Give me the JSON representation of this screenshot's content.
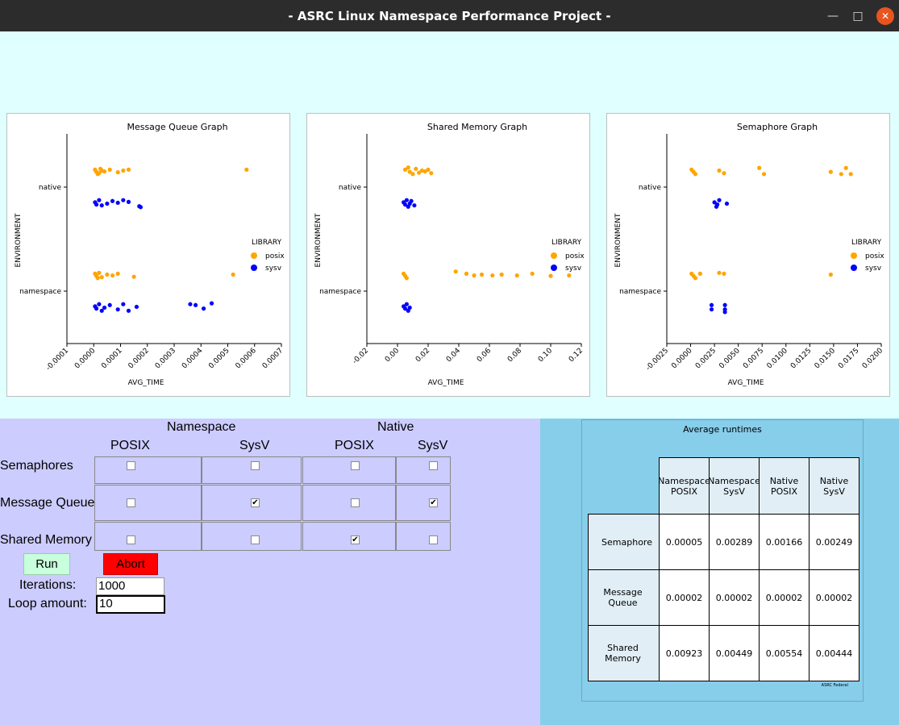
{
  "window": {
    "title": "- ASRC Linux Namespace Performance Project -"
  },
  "charts": [
    {
      "title": "Message Queue Graph",
      "xlabel": "AVG_TIME",
      "ylabel": "ENVIRONMENT",
      "yticks": [
        "native",
        "namespace"
      ],
      "xticks": [
        "-0.0001",
        "0.0000",
        "0.0001",
        "0.0002",
        "0.0003",
        "0.0004",
        "0.0005",
        "0.0006",
        "0.0007"
      ],
      "legend_title": "LIBRARY",
      "legend": [
        "posix",
        "sysv"
      ]
    },
    {
      "title": "Shared Memory Graph",
      "xlabel": "AVG_TIME",
      "ylabel": "ENVIRONMENT",
      "yticks": [
        "native",
        "namespace"
      ],
      "xticks": [
        "-0.02",
        "0.00",
        "0.02",
        "0.04",
        "0.06",
        "0.08",
        "0.10",
        "0.12"
      ],
      "legend_title": "LIBRARY",
      "legend": [
        "posix",
        "sysv"
      ]
    },
    {
      "title": "Semaphore Graph",
      "xlabel": "AVG_TIME",
      "ylabel": "ENVIRONMENT",
      "yticks": [
        "native",
        "namespace"
      ],
      "xticks": [
        "-0.0025",
        "0.0000",
        "0.0025",
        "0.0050",
        "0.0075",
        "0.0100",
        "0.0125",
        "0.0150",
        "0.0175",
        "0.0200"
      ],
      "legend_title": "LIBRARY",
      "legend": [
        "posix",
        "sysv"
      ]
    }
  ],
  "chart_data": [
    {
      "type": "scatter",
      "title": "Message Queue Graph",
      "xlabel": "AVG_TIME",
      "ylabel": "ENVIRONMENT",
      "xlim": [
        -0.0001,
        0.0007
      ],
      "categories": [
        "native",
        "namespace"
      ],
      "legend_position": "right",
      "series": [
        {
          "name": "posix",
          "color": "#ffa500",
          "points": [
            {
              "env": "native",
              "offset": -0.4,
              "x": 5e-06
            },
            {
              "env": "native",
              "offset": -0.35,
              "x": 1e-05
            },
            {
              "env": "native",
              "offset": -0.3,
              "x": 1.5e-05
            },
            {
              "env": "native",
              "offset": -0.32,
              "x": 2e-05
            },
            {
              "env": "native",
              "offset": -0.42,
              "x": 2.5e-05
            },
            {
              "env": "native",
              "offset": -0.38,
              "x": 3e-05
            },
            {
              "env": "native",
              "offset": -0.36,
              "x": 4e-05
            },
            {
              "env": "native",
              "offset": -0.4,
              "x": 6e-05
            },
            {
              "env": "native",
              "offset": -0.34,
              "x": 9e-05
            },
            {
              "env": "native",
              "offset": -0.38,
              "x": 0.00011
            },
            {
              "env": "native",
              "offset": -0.4,
              "x": 0.00013
            },
            {
              "env": "native",
              "offset": -0.4,
              "x": 0.00057
            },
            {
              "env": "namespace",
              "offset": -0.4,
              "x": 5e-06
            },
            {
              "env": "namespace",
              "offset": -0.35,
              "x": 1e-05
            },
            {
              "env": "namespace",
              "offset": -0.3,
              "x": 1.5e-05
            },
            {
              "env": "namespace",
              "offset": -0.42,
              "x": 2e-05
            },
            {
              "env": "namespace",
              "offset": -0.32,
              "x": 3e-05
            },
            {
              "env": "namespace",
              "offset": -0.38,
              "x": 5e-05
            },
            {
              "env": "namespace",
              "offset": -0.36,
              "x": 7e-05
            },
            {
              "env": "namespace",
              "offset": -0.4,
              "x": 9e-05
            },
            {
              "env": "namespace",
              "offset": -0.33,
              "x": 0.00015
            },
            {
              "env": "namespace",
              "offset": -0.38,
              "x": 0.00052
            }
          ]
        },
        {
          "name": "sysv",
          "color": "#0000ff",
          "points": [
            {
              "env": "native",
              "offset": 0.35,
              "x": 5e-06
            },
            {
              "env": "native",
              "offset": 0.4,
              "x": 1e-05
            },
            {
              "env": "native",
              "offset": 0.3,
              "x": 2e-05
            },
            {
              "env": "native",
              "offset": 0.42,
              "x": 3e-05
            },
            {
              "env": "native",
              "offset": 0.38,
              "x": 5e-05
            },
            {
              "env": "native",
              "offset": 0.32,
              "x": 7e-05
            },
            {
              "env": "native",
              "offset": 0.36,
              "x": 9e-05
            },
            {
              "env": "native",
              "offset": 0.3,
              "x": 0.00011
            },
            {
              "env": "native",
              "offset": 0.34,
              "x": 0.00013
            },
            {
              "env": "native",
              "offset": 0.44,
              "x": 0.00017
            },
            {
              "env": "native",
              "offset": 0.46,
              "x": 0.000175
            },
            {
              "env": "namespace",
              "offset": 0.35,
              "x": 5e-06
            },
            {
              "env": "namespace",
              "offset": 0.4,
              "x": 1e-05
            },
            {
              "env": "namespace",
              "offset": 0.3,
              "x": 2e-05
            },
            {
              "env": "namespace",
              "offset": 0.45,
              "x": 3e-05
            },
            {
              "env": "namespace",
              "offset": 0.38,
              "x": 4e-05
            },
            {
              "env": "namespace",
              "offset": 0.32,
              "x": 6e-05
            },
            {
              "env": "namespace",
              "offset": 0.42,
              "x": 9e-05
            },
            {
              "env": "namespace",
              "offset": 0.3,
              "x": 0.00011
            },
            {
              "env": "namespace",
              "offset": 0.45,
              "x": 0.00013
            },
            {
              "env": "namespace",
              "offset": 0.36,
              "x": 0.00016
            },
            {
              "env": "namespace",
              "offset": 0.3,
              "x": 0.00036
            },
            {
              "env": "namespace",
              "offset": 0.32,
              "x": 0.00038
            },
            {
              "env": "namespace",
              "offset": 0.4,
              "x": 0.00041
            },
            {
              "env": "namespace",
              "offset": 0.28,
              "x": 0.00044
            }
          ]
        }
      ]
    },
    {
      "type": "scatter",
      "title": "Shared Memory Graph",
      "xlabel": "AVG_TIME",
      "ylabel": "ENVIRONMENT",
      "xlim": [
        -0.02,
        0.12
      ],
      "categories": [
        "native",
        "namespace"
      ],
      "legend_position": "right",
      "series": [
        {
          "name": "posix",
          "color": "#ffa500",
          "points": [
            {
              "env": "native",
              "offset": -0.4,
              "x": 0.005
            },
            {
              "env": "native",
              "offset": -0.35,
              "x": 0.008
            },
            {
              "env": "native",
              "offset": -0.3,
              "x": 0.01
            },
            {
              "env": "native",
              "offset": -0.42,
              "x": 0.012
            },
            {
              "env": "native",
              "offset": -0.33,
              "x": 0.014
            },
            {
              "env": "native",
              "offset": -0.38,
              "x": 0.016
            },
            {
              "env": "native",
              "offset": -0.36,
              "x": 0.018
            },
            {
              "env": "native",
              "offset": -0.4,
              "x": 0.02
            },
            {
              "env": "native",
              "offset": -0.32,
              "x": 0.022
            },
            {
              "env": "native",
              "offset": -0.45,
              "x": 0.007
            },
            {
              "env": "namespace",
              "offset": -0.4,
              "x": 0.004
            },
            {
              "env": "namespace",
              "offset": -0.35,
              "x": 0.005
            },
            {
              "env": "namespace",
              "offset": -0.3,
              "x": 0.006
            },
            {
              "env": "namespace",
              "offset": -0.45,
              "x": 0.038
            },
            {
              "env": "namespace",
              "offset": -0.4,
              "x": 0.045
            },
            {
              "env": "namespace",
              "offset": -0.36,
              "x": 0.05
            },
            {
              "env": "namespace",
              "offset": -0.38,
              "x": 0.055
            },
            {
              "env": "namespace",
              "offset": -0.36,
              "x": 0.062
            },
            {
              "env": "namespace",
              "offset": -0.38,
              "x": 0.068
            },
            {
              "env": "namespace",
              "offset": -0.36,
              "x": 0.078
            },
            {
              "env": "namespace",
              "offset": -0.4,
              "x": 0.088
            },
            {
              "env": "namespace",
              "offset": -0.35,
              "x": 0.1
            },
            {
              "env": "namespace",
              "offset": -0.36,
              "x": 0.112
            }
          ]
        },
        {
          "name": "sysv",
          "color": "#0000ff",
          "points": [
            {
              "env": "native",
              "offset": 0.35,
              "x": 0.004
            },
            {
              "env": "native",
              "offset": 0.4,
              "x": 0.005
            },
            {
              "env": "native",
              "offset": 0.3,
              "x": 0.006
            },
            {
              "env": "native",
              "offset": 0.45,
              "x": 0.007
            },
            {
              "env": "native",
              "offset": 0.38,
              "x": 0.008
            },
            {
              "env": "native",
              "offset": 0.32,
              "x": 0.009
            },
            {
              "env": "native",
              "offset": 0.42,
              "x": 0.011
            },
            {
              "env": "namespace",
              "offset": 0.35,
              "x": 0.004
            },
            {
              "env": "namespace",
              "offset": 0.4,
              "x": 0.005
            },
            {
              "env": "namespace",
              "offset": 0.3,
              "x": 0.006
            },
            {
              "env": "namespace",
              "offset": 0.45,
              "x": 0.007
            },
            {
              "env": "namespace",
              "offset": 0.38,
              "x": 0.008
            }
          ]
        }
      ]
    },
    {
      "type": "scatter",
      "title": "Semaphore Graph",
      "xlabel": "AVG_TIME",
      "ylabel": "ENVIRONMENT",
      "xlim": [
        -0.0025,
        0.02
      ],
      "categories": [
        "native",
        "namespace"
      ],
      "legend_position": "right",
      "series": [
        {
          "name": "posix",
          "color": "#ffa500",
          "points": [
            {
              "env": "native",
              "offset": -0.4,
              "x": 0.0001
            },
            {
              "env": "native",
              "offset": -0.35,
              "x": 0.0003
            },
            {
              "env": "native",
              "offset": -0.3,
              "x": 0.0005
            },
            {
              "env": "native",
              "offset": -0.38,
              "x": 0.003
            },
            {
              "env": "native",
              "offset": -0.32,
              "x": 0.0035
            },
            {
              "env": "native",
              "offset": -0.44,
              "x": 0.0072
            },
            {
              "env": "native",
              "offset": -0.3,
              "x": 0.0077
            },
            {
              "env": "native",
              "offset": -0.35,
              "x": 0.0147
            },
            {
              "env": "native",
              "offset": -0.3,
              "x": 0.0158
            },
            {
              "env": "native",
              "offset": -0.44,
              "x": 0.0163
            },
            {
              "env": "native",
              "offset": -0.3,
              "x": 0.0168
            },
            {
              "env": "namespace",
              "offset": -0.4,
              "x": 0.0001
            },
            {
              "env": "namespace",
              "offset": -0.35,
              "x": 0.0003
            },
            {
              "env": "namespace",
              "offset": -0.3,
              "x": 0.0005
            },
            {
              "env": "namespace",
              "offset": -0.4,
              "x": 0.001
            },
            {
              "env": "namespace",
              "offset": -0.42,
              "x": 0.003
            },
            {
              "env": "namespace",
              "offset": -0.4,
              "x": 0.0035
            },
            {
              "env": "namespace",
              "offset": -0.38,
              "x": 0.0147
            }
          ]
        },
        {
          "name": "sysv",
          "color": "#0000ff",
          "points": [
            {
              "env": "native",
              "offset": 0.35,
              "x": 0.0025
            },
            {
              "env": "native",
              "offset": 0.4,
              "x": 0.0028
            },
            {
              "env": "native",
              "offset": 0.3,
              "x": 0.003
            },
            {
              "env": "native",
              "offset": 0.45,
              "x": 0.0027
            },
            {
              "env": "native",
              "offset": 0.38,
              "x": 0.0038
            },
            {
              "env": "namespace",
              "offset": 0.32,
              "x": 0.0022
            },
            {
              "env": "namespace",
              "offset": 0.42,
              "x": 0.0022
            },
            {
              "env": "namespace",
              "offset": 0.32,
              "x": 0.0036
            },
            {
              "env": "namespace",
              "offset": 0.42,
              "x": 0.0036
            },
            {
              "env": "namespace",
              "offset": 0.48,
              "x": 0.0036
            }
          ]
        }
      ]
    }
  ],
  "controls": {
    "group_headers": [
      "Namespace",
      "Native"
    ],
    "column_headers": [
      "POSIX",
      "SysV",
      "POSIX",
      "SysV"
    ],
    "rows": [
      {
        "label": "Semaphores",
        "checks": [
          false,
          false,
          false,
          false
        ]
      },
      {
        "label": "Message Queue",
        "checks": [
          false,
          true,
          false,
          true
        ]
      },
      {
        "label": "Shared Memory",
        "checks": [
          false,
          false,
          true,
          false
        ]
      }
    ],
    "run_label": "Run",
    "abort_label": "Abort",
    "iterations_label": "Iterations:",
    "iterations_value": "1000",
    "loop_label": "Loop amount:",
    "loop_value": "10"
  },
  "results": {
    "title": "Average runtimes",
    "col_headers": [
      "Namespace\nPOSIX",
      "Namespace\nSysV",
      "Native\nPOSIX",
      "Native\nSysV"
    ],
    "rows": [
      {
        "label": "Semaphore",
        "values": [
          "0.00005",
          "0.00289",
          "0.00166",
          "0.00249"
        ]
      },
      {
        "label": "Message Queue",
        "values": [
          "0.00002",
          "0.00002",
          "0.00002",
          "0.00002"
        ]
      },
      {
        "label": "Shared Memory",
        "values": [
          "0.00923",
          "0.00449",
          "0.00554",
          "0.00444"
        ]
      }
    ],
    "footer": "ASRC Federal"
  },
  "colors": {
    "posix": "#ffa500",
    "sysv": "#0000ff"
  }
}
